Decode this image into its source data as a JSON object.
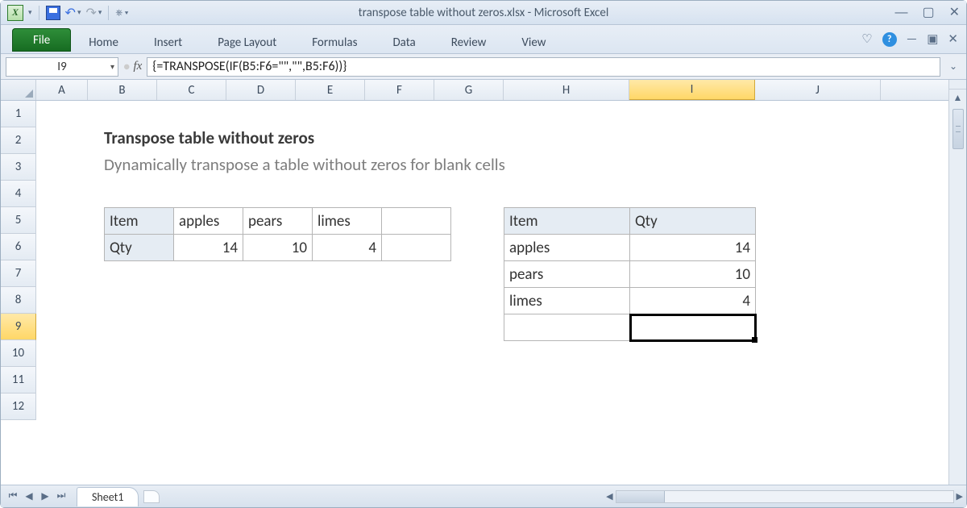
{
  "window": {
    "title": "transpose table without zeros.xlsx  -  Microsoft Excel"
  },
  "qat": {
    "excel_glyph": "X"
  },
  "ribbon": {
    "file": "File",
    "tabs": [
      "Home",
      "Insert",
      "Page Layout",
      "Formulas",
      "Data",
      "Review",
      "View"
    ]
  },
  "namebox": "I9",
  "formula": "{=TRANSPOSE(IF(B5:F6=\"\",\"\",B5:F6))}",
  "columns": [
    "A",
    "B",
    "C",
    "D",
    "E",
    "F",
    "G",
    "H",
    "I",
    "J"
  ],
  "active_col": "I",
  "rows": [
    1,
    2,
    3,
    4,
    5,
    6,
    7,
    8,
    9,
    10,
    11,
    12
  ],
  "active_row": 9,
  "sheet": {
    "title": "Transpose table without zeros",
    "subtitle": "Dynamically transpose a table without zeros for blank cells"
  },
  "table_src": {
    "row_headers": [
      "Item",
      "Qty"
    ],
    "cols": [
      {
        "item": "apples",
        "qty": "14"
      },
      {
        "item": "pears",
        "qty": "10"
      },
      {
        "item": "limes",
        "qty": "4"
      },
      {
        "item": "",
        "qty": ""
      }
    ]
  },
  "table_dst": {
    "headers": [
      "Item",
      "Qty"
    ],
    "rows": [
      {
        "item": "apples",
        "qty": "14"
      },
      {
        "item": "pears",
        "qty": "10"
      },
      {
        "item": "limes",
        "qty": "4"
      },
      {
        "item": "",
        "qty": ""
      }
    ]
  },
  "sheet_tab": "Sheet1"
}
